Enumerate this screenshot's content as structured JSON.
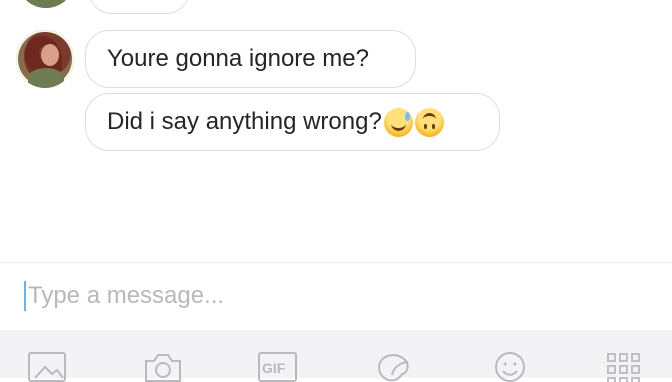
{
  "conversation": {
    "messages": [
      {
        "text": "Youre gonna ignore me?",
        "emojis": []
      },
      {
        "text": "Did i say anything wrong?",
        "emojis": [
          "grinning-sweat-emoji",
          "upside-down-face-emoji"
        ]
      }
    ]
  },
  "composer": {
    "placeholder": "Type a message..."
  },
  "toolbar": {
    "items": [
      {
        "icon": "image-icon"
      },
      {
        "icon": "camera-icon"
      },
      {
        "icon": "gif-icon",
        "label": "GIF"
      },
      {
        "icon": "sticker-icon"
      },
      {
        "icon": "emoji-icon"
      },
      {
        "icon": "apps-grid-icon"
      }
    ]
  },
  "colors": {
    "background": "#ffffff",
    "bubble_border": "#dddddd",
    "cursor": "#5cb4ff",
    "toolbar_background": "#f3f3f5",
    "toolbar_icon": "#b9b9bf",
    "placeholder": "#b8b8b8"
  }
}
